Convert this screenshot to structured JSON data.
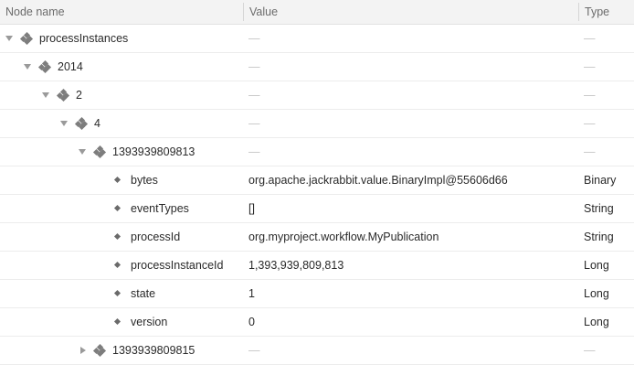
{
  "columns": {
    "name": "Node name",
    "value": "Value",
    "type": "Type"
  },
  "empty": "—",
  "rows": [
    {
      "label": "processInstances",
      "value": "—",
      "type": "—"
    },
    {
      "label": "2014",
      "value": "—",
      "type": "—"
    },
    {
      "label": "2",
      "value": "—",
      "type": "—"
    },
    {
      "label": "4",
      "value": "—",
      "type": "—"
    },
    {
      "label": "1393939809813",
      "value": "—",
      "type": "—"
    },
    {
      "label": "bytes",
      "value": "org.apache.jackrabbit.value.BinaryImpl@55606d66",
      "type": "Binary"
    },
    {
      "label": "eventTypes",
      "value": "[]",
      "type": "String"
    },
    {
      "label": "processId",
      "value": "org.myproject.workflow.MyPublication",
      "type": "String"
    },
    {
      "label": "processInstanceId",
      "value": "1,393,939,809,813",
      "type": "Long"
    },
    {
      "label": "state",
      "value": "1",
      "type": "Long"
    },
    {
      "label": "version",
      "value": "0",
      "type": "Long"
    },
    {
      "label": "1393939809815",
      "value": "—",
      "type": "—"
    }
  ]
}
